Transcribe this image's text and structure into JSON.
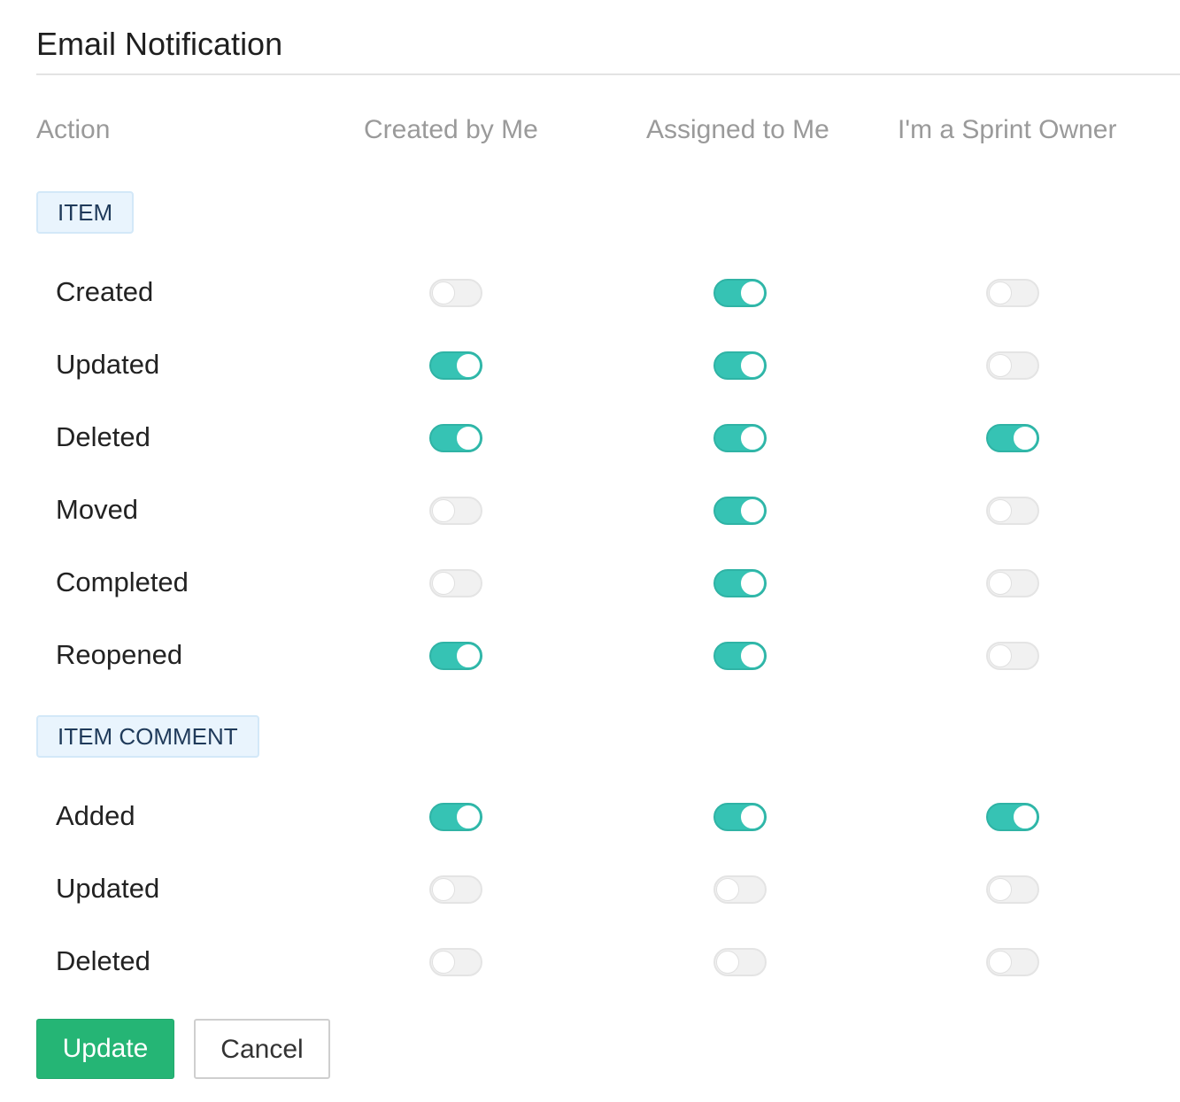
{
  "title": "Email Notification",
  "columns": {
    "action": "Action",
    "created_by_me": "Created by Me",
    "assigned_to_me": "Assigned to Me",
    "sprint_owner": "I'm a Sprint Owner"
  },
  "colors": {
    "toggle_on": "#36c3b4",
    "toggle_off": "#f1f1f1",
    "update_button": "#25b575",
    "badge_background": "#e9f4fd"
  },
  "sections": [
    {
      "label": "ITEM",
      "rows": [
        {
          "label": "Created",
          "toggles": [
            false,
            true,
            false
          ]
        },
        {
          "label": "Updated",
          "toggles": [
            true,
            true,
            false
          ]
        },
        {
          "label": "Deleted",
          "toggles": [
            true,
            true,
            true
          ]
        },
        {
          "label": "Moved",
          "toggles": [
            false,
            true,
            false
          ]
        },
        {
          "label": "Completed",
          "toggles": [
            false,
            true,
            false
          ]
        },
        {
          "label": "Reopened",
          "toggles": [
            true,
            true,
            false
          ]
        }
      ]
    },
    {
      "label": "ITEM COMMENT",
      "rows": [
        {
          "label": "Added",
          "toggles": [
            true,
            true,
            true
          ]
        },
        {
          "label": "Updated",
          "toggles": [
            false,
            false,
            false
          ]
        },
        {
          "label": "Deleted",
          "toggles": [
            false,
            false,
            false
          ]
        }
      ]
    }
  ],
  "buttons": {
    "update": "Update",
    "cancel": "Cancel"
  }
}
